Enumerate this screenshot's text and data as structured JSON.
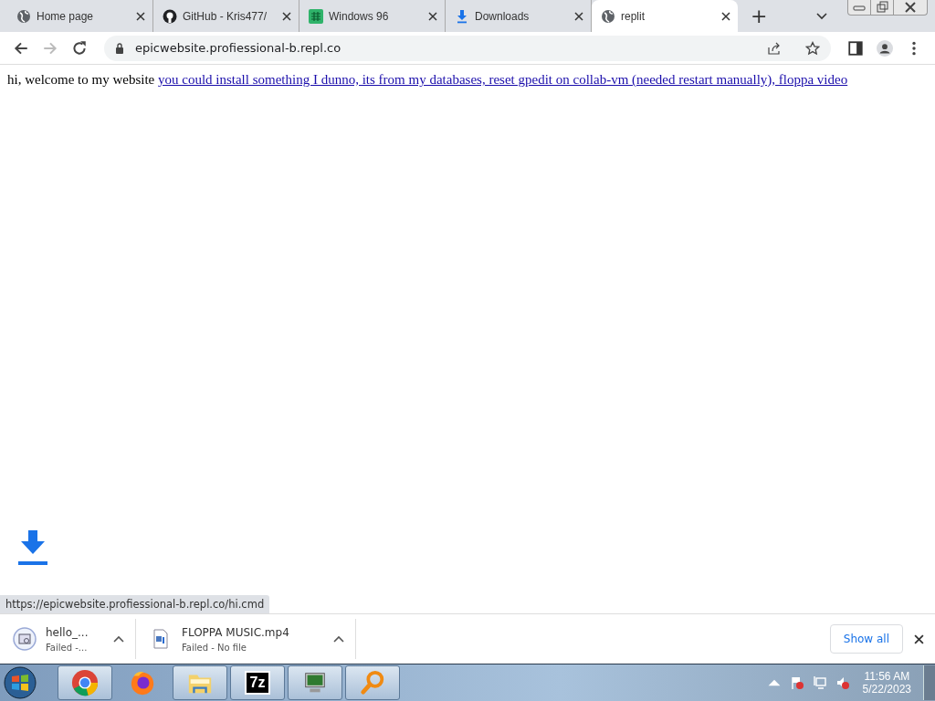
{
  "tabs": [
    {
      "title": "Home page",
      "kind": "globe",
      "selected": false
    },
    {
      "title": "GitHub - Kris477/",
      "kind": "github",
      "selected": false
    },
    {
      "title": "Windows 96",
      "kind": "win96",
      "selected": false
    },
    {
      "title": "Downloads",
      "kind": "download",
      "selected": false
    },
    {
      "title": "replit",
      "kind": "globe",
      "selected": true
    }
  ],
  "new_tab": "+",
  "address_bar": {
    "url": "epicwebsite.profiessional-b.repl.co"
  },
  "page": {
    "text": "hi, welcome to my website",
    "link": "you could install something I dunno, its from my databases, reset gpedit on collab-vm (needed restart manually), floppa video"
  },
  "status_url": "https://epicwebsite.profiessional-b.repl.co/hi.cmd",
  "download_shelf": {
    "items": [
      {
        "name": "hello_...",
        "status": "Failed -...",
        "kind": "setup"
      },
      {
        "name": "FLOPPA MUSIC.mp4",
        "status": "Failed - No file",
        "kind": "media"
      }
    ],
    "show_all": "Show all"
  },
  "taskbar": {
    "apps": [
      {
        "kind": "chrome",
        "running": true
      },
      {
        "kind": "firefox",
        "running": false
      },
      {
        "kind": "explorer",
        "running": true
      },
      {
        "kind": "sevenzip",
        "label": "7z",
        "running": true
      },
      {
        "kind": "monitor",
        "running": true
      },
      {
        "kind": "search",
        "running": true
      }
    ],
    "time": "11:56 AM",
    "date": "5/22/2023"
  }
}
